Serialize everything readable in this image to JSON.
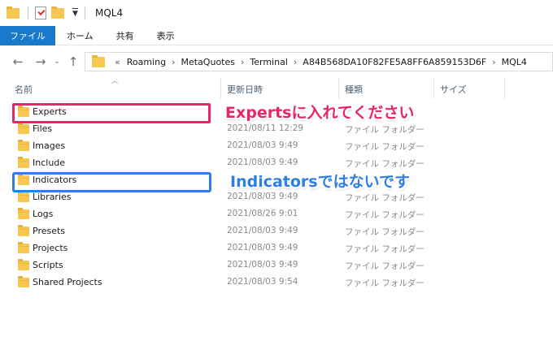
{
  "window": {
    "title": "MQL4"
  },
  "ribbon": {
    "tabs": [
      "ファイル",
      "ホーム",
      "共有",
      "表示"
    ]
  },
  "address": {
    "lead": "«",
    "crumbs": [
      "Roaming",
      "MetaQuotes",
      "Terminal",
      "A84B568DA10F82FE5A8FF6A859153D6F",
      "MQL4"
    ],
    "separator": "›"
  },
  "columns": {
    "name": "名前",
    "modified": "更新日時",
    "type": "種類",
    "size": "サイズ"
  },
  "files": [
    {
      "name": "Experts",
      "date": "",
      "type": ""
    },
    {
      "name": "Files",
      "date": "2021/08/11 12:29",
      "type": "ファイル フォルダー"
    },
    {
      "name": "Images",
      "date": "2021/08/03 9:49",
      "type": "ファイル フォルダー"
    },
    {
      "name": "Include",
      "date": "2021/08/03 9:49",
      "type": "ファイル フォルダー"
    },
    {
      "name": "Indicators",
      "date": "",
      "type": ""
    },
    {
      "name": "Libraries",
      "date": "2021/08/03 9:49",
      "type": "ファイル フォルダー"
    },
    {
      "name": "Logs",
      "date": "2021/08/26 9:01",
      "type": "ファイル フォルダー"
    },
    {
      "name": "Presets",
      "date": "2021/08/03 9:49",
      "type": "ファイル フォルダー"
    },
    {
      "name": "Projects",
      "date": "2021/08/03 9:49",
      "type": "ファイル フォルダー"
    },
    {
      "name": "Scripts",
      "date": "2021/08/03 9:49",
      "type": "ファイル フォルダー"
    },
    {
      "name": "Shared Projects",
      "date": "2021/08/03 9:54",
      "type": "ファイル フォルダー"
    }
  ],
  "annotations": {
    "experts": "Expertsに入れてください",
    "indicators": "Indicatorsではないです",
    "experts_color": "#e8256b",
    "indicators_color": "#2d7fe3"
  },
  "colors": {
    "ribbon_active": "#1979ca",
    "folder": "#f6c752"
  }
}
